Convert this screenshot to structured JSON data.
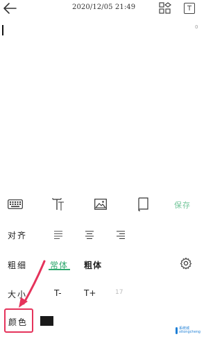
{
  "header": {
    "datetime": "2020/12/05 21:49",
    "text_button_label": "T"
  },
  "editor": {
    "char_count": "0"
  },
  "toolbar": {
    "icons": [
      "keyboard-icon",
      "font-style-icon",
      "image-icon",
      "notebook-icon"
    ],
    "save_label": "保存"
  },
  "format_panel": {
    "align_label": "对齐",
    "weight_label": "粗细",
    "weight_options": [
      "常体",
      "粗体"
    ],
    "weight_selected": "常体",
    "size_label": "大小",
    "size_options": [
      "T-",
      "T+",
      "17"
    ],
    "color_label": "颜色",
    "current_color": "#1a1a1a",
    "accent_color": "#2fa86e",
    "highlight_color": "#e5335b"
  },
  "watermark": {
    "line1": "系统城",
    "line2": "xitongcheng"
  }
}
